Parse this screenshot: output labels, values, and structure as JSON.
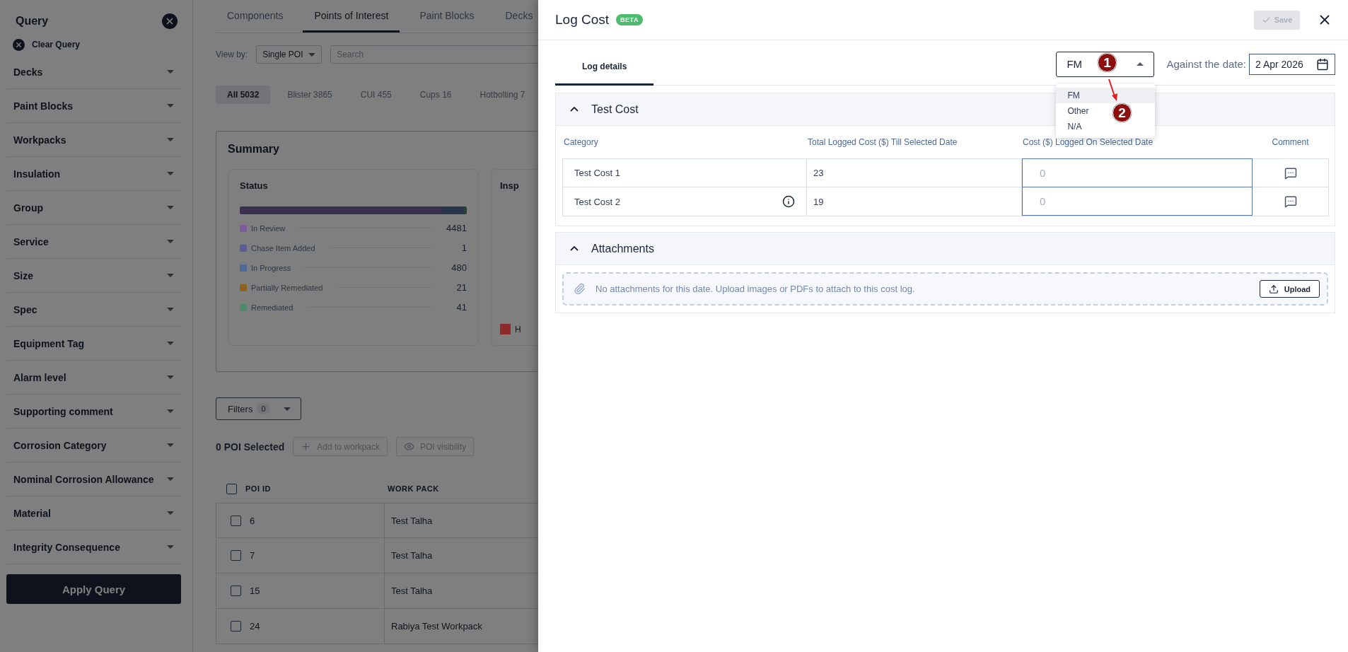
{
  "sidebar": {
    "title": "Query",
    "clear_label": "Clear Query",
    "filters": [
      {
        "label": "Decks"
      },
      {
        "label": "Paint Blocks"
      },
      {
        "label": "Workpacks"
      },
      {
        "label": "Insulation"
      },
      {
        "label": "Group"
      },
      {
        "label": "Service"
      },
      {
        "label": "Size"
      },
      {
        "label": "Spec"
      },
      {
        "label": "Equipment Tag"
      },
      {
        "label": "Alarm level"
      },
      {
        "label": "Supporting comment"
      },
      {
        "label": "Corrosion Category"
      },
      {
        "label": "Nominal Corrosion Allowance"
      },
      {
        "label": "Material"
      },
      {
        "label": "Integrity Consequence"
      }
    ],
    "apply_label": "Apply Query"
  },
  "main": {
    "tabs": [
      {
        "label": "Components",
        "selected": false
      },
      {
        "label": "Points of Interest",
        "selected": true
      },
      {
        "label": "Paint Blocks",
        "selected": false
      },
      {
        "label": "Decks",
        "selected": false
      }
    ],
    "view_by": {
      "label": "View by:",
      "value": "Single POI"
    },
    "search": {
      "placeholder": "Search"
    },
    "chips": [
      {
        "label": "All 5032",
        "selected": true
      },
      {
        "label": "Blister 3865",
        "selected": false
      },
      {
        "label": "CUI 455",
        "selected": false
      },
      {
        "label": "Cups 16",
        "selected": false
      },
      {
        "label": "Hotbolting 7",
        "selected": false
      }
    ],
    "summary": {
      "title": "Summary",
      "status": {
        "title": "Status",
        "items": [
          {
            "label": "In Review",
            "count": "4481",
            "color": "#7d5c9e"
          },
          {
            "label": "Chase Item Added",
            "count": "1",
            "color": "#5d5c94"
          },
          {
            "label": "In Progress",
            "count": "480",
            "color": "#4f6a96"
          },
          {
            "label": "Partially Remediated",
            "count": "21",
            "color": "#8c6420"
          },
          {
            "label": "Remediated",
            "count": "41",
            "color": "#4a8a6a"
          }
        ]
      },
      "inspection": {
        "title": "Insp",
        "legend": [
          {
            "label": "H",
            "color": "#8e2a2a"
          }
        ]
      }
    },
    "filters_button": {
      "label": "Filters",
      "count": "0"
    },
    "selection": {
      "label": "0 POI Selected",
      "actions": [
        {
          "label": "Add to workpack",
          "kind": "add"
        },
        {
          "label": "POI visibility",
          "kind": "visibility"
        }
      ]
    },
    "table": {
      "columns": [
        "POI ID",
        "WORK PACK"
      ],
      "select_all": false,
      "rows": [
        {
          "id": "6",
          "work_pack": "Test Talha",
          "checked": false
        },
        {
          "id": "7",
          "work_pack": "Test Talha",
          "checked": false
        },
        {
          "id": "15",
          "work_pack": "Test Talha",
          "checked": false
        },
        {
          "id": "24",
          "work_pack": "Rabiya Test Workpack",
          "checked": false
        }
      ]
    }
  },
  "drawer": {
    "title": "Log Cost",
    "badge": "BETA",
    "save": {
      "label": "Save",
      "disabled": true
    },
    "tabs": [
      {
        "label": "Log details",
        "selected": true
      }
    ],
    "type_select": {
      "value": "FM",
      "open": true,
      "options": [
        {
          "label": "FM",
          "selected": true
        },
        {
          "label": "Other",
          "selected": false
        },
        {
          "label": "N/A",
          "selected": false
        }
      ]
    },
    "date": {
      "label": "Against the date:",
      "value": "2 Apr 2026"
    },
    "cost_section": {
      "title": "Test Cost",
      "expanded": true,
      "columns": [
        "Category",
        "Total Logged Cost ($) Till Selected Date",
        "Cost ($) Logged On Selected Date",
        "Comment"
      ],
      "rows": [
        {
          "category": "Test Cost 1",
          "info": false,
          "total": "23",
          "placeholder": "0"
        },
        {
          "category": "Test Cost 2",
          "info": true,
          "total": "19",
          "placeholder": "0"
        }
      ]
    },
    "attachments": {
      "title": "Attachments",
      "expanded": true,
      "message": "No attachments for this date. Upload images or PDFs to attach to this cost log.",
      "upload_label": "Upload"
    }
  },
  "annotations": [
    {
      "label": "1"
    },
    {
      "label": "2"
    }
  ]
}
